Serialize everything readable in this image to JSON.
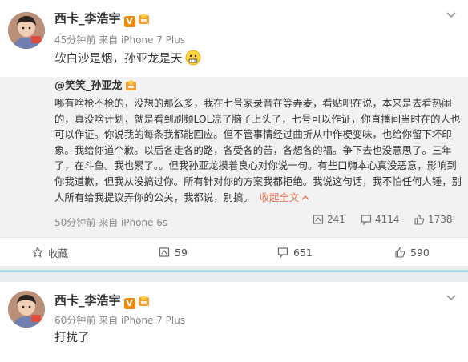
{
  "post1": {
    "username": "西卡_李浩宇",
    "verified_badge": "V",
    "meta": "45分钟前 来自 iPhone 7 Plus",
    "text": "软白沙是烟，孙亚龙是天",
    "emoji": "grimace-emoji",
    "quote": {
      "author": "@笑笑_孙亚龙",
      "lines": [
        "哪有啥枪不枪的，没想的那么多，我在七号家录音在等弄麦，看贴吧在说，本来是去看热闹",
        "的，真没啥计划，就是看到刷频LOL凉了脑子上头了，七号可以作证，你直播间当时在的人也",
        "可以作证。你说我的每条我都能回应。但不管事情经过曲折从中作梗变味，也给你留下坏印",
        "象。我给你道个歉。以后各走各的路，各受各的苦，各想各的福。争下去也没意思了。三年",
        "了，在斗鱼。我也累了。。但我孙亚龙摸着良心对你说一句。有些口嗨本心真没恶意，影响到",
        "你我道歉，但我从没搞过你。所有针对你的方案我都拒绝。我说这句话，我不怕任何人锤，别",
        "人所有给我提议弄你的公关，我都说，别搞。"
      ],
      "collapse_label": "收起全文",
      "collapse_icon": "chevron-up-icon",
      "meta": "50分钟前 来自 iPhone 6s",
      "reposts": "241",
      "comments": "4114",
      "likes": "1738"
    },
    "actions": {
      "favorite": "收藏",
      "repost": "59",
      "comment": "651",
      "like": "590"
    }
  },
  "post2": {
    "username": "西卡_李浩宇",
    "verified_badge": "V",
    "meta": "60分钟前 来自 iPhone 7 Plus",
    "text": "打扰了"
  },
  "colors": {
    "link": "#eb7350",
    "verified": "#f28a00",
    "separator": "#e9edf0"
  }
}
